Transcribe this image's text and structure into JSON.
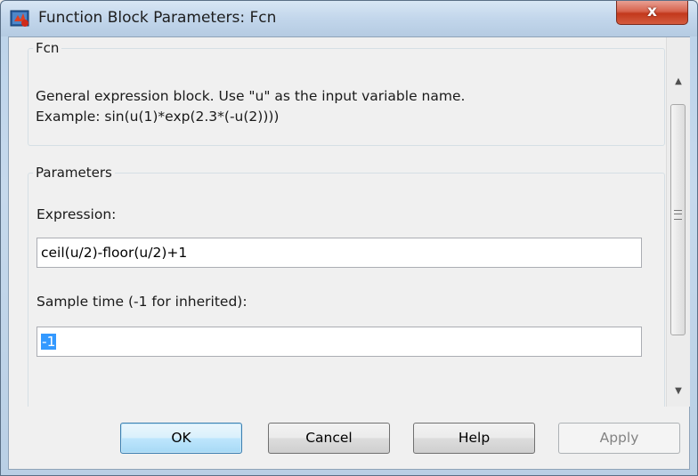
{
  "window": {
    "title": "Function Block Parameters: Fcn",
    "close_glyph": "x"
  },
  "block_group": {
    "title": "Fcn",
    "description_line1": "General expression block. Use \"u\" as the input variable name.",
    "description_line2": "Example: sin(u(1)*exp(2.3*(-u(2))))"
  },
  "parameters_group": {
    "title": "Parameters",
    "expression_label": "Expression:",
    "expression_value": "ceil(u/2)-floor(u/2)+1",
    "sample_time_label": "Sample time (-1 for inherited):",
    "sample_time_value": "-1"
  },
  "buttons": {
    "ok": "OK",
    "cancel": "Cancel",
    "help": "Help",
    "apply": "Apply"
  },
  "scrollbar": {
    "up_glyph": "▲",
    "down_glyph": "▼"
  },
  "colors": {
    "selection": "#3399ff",
    "close_button": "#c2381c",
    "window_frame": "#c6d9ec"
  }
}
